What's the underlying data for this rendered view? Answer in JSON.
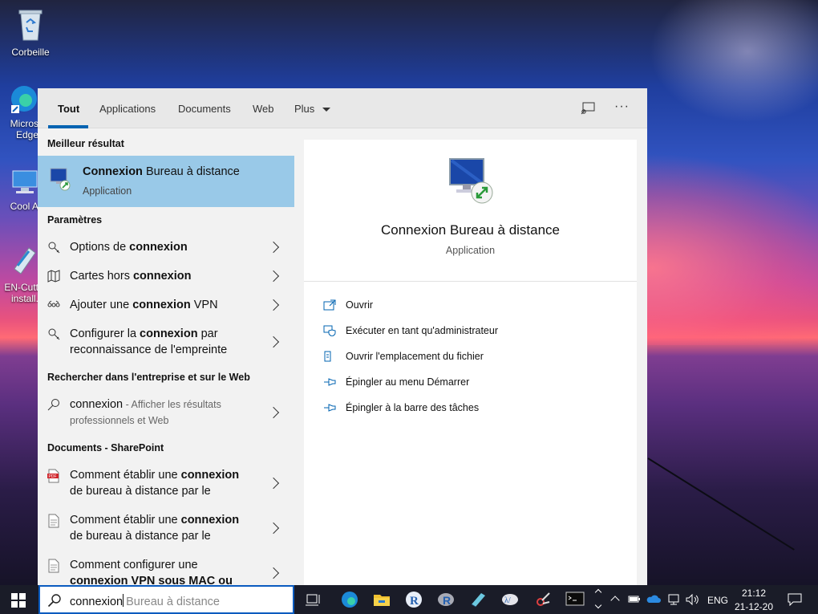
{
  "desktop": {
    "icons": [
      {
        "label": "Corbeille"
      },
      {
        "label": "Micros\nEdge"
      },
      {
        "label": "Cool A"
      },
      {
        "label": "EN-Cutt\ninstall."
      }
    ]
  },
  "tabs": [
    "Tout",
    "Applications",
    "Documents",
    "Web",
    "Plus"
  ],
  "sections": {
    "best": "Meilleur résultat",
    "params": "Paramètres",
    "web": "Rechercher dans l'entreprise et sur le Web",
    "docs": "Documents - SharePoint"
  },
  "best": {
    "bold": "Connexion",
    "rest": " Bureau à distance",
    "sub": "Application"
  },
  "settings": [
    {
      "pre": "Options de ",
      "bold": "connexion",
      "post": ""
    },
    {
      "pre": "Cartes hors ",
      "bold": "connexion",
      "post": ""
    },
    {
      "pre": "Ajouter une ",
      "bold": "connexion",
      "post": " VPN"
    },
    {
      "pre": "Configurer la ",
      "bold": "connexion",
      "post": " par",
      "line2": "reconnaissance de l'empreinte"
    }
  ],
  "web": {
    "query": "connexion",
    "hint": " - Afficher les résultats",
    "hint2": "professionnels et Web"
  },
  "docs": [
    {
      "pre": "Comment établir une ",
      "bold": "connexion",
      "line2": "de bureau à distance par le"
    },
    {
      "pre": "Comment établir une ",
      "bold": "connexion",
      "line2": "de bureau à distance par le"
    },
    {
      "pre": "Comment configurer une",
      "bold": "",
      "line2": "connexion VPN sous MAC ou"
    }
  ],
  "preview": {
    "title": "Connexion Bureau à distance",
    "sub": "Application"
  },
  "actions": [
    "Ouvrir",
    "Exécuter en tant qu'administrateur",
    "Ouvrir l'emplacement du fichier",
    "Épingler au menu Démarrer",
    "Épingler à la barre des tâches"
  ],
  "search": {
    "typed": "connexion",
    "suggestion": "Bureau à distance"
  },
  "tray": {
    "lang": "ENG",
    "time": "21:12",
    "date": "21-12-20"
  },
  "colors": {
    "accent": "#0063b1",
    "selected": "#99c9e8"
  }
}
